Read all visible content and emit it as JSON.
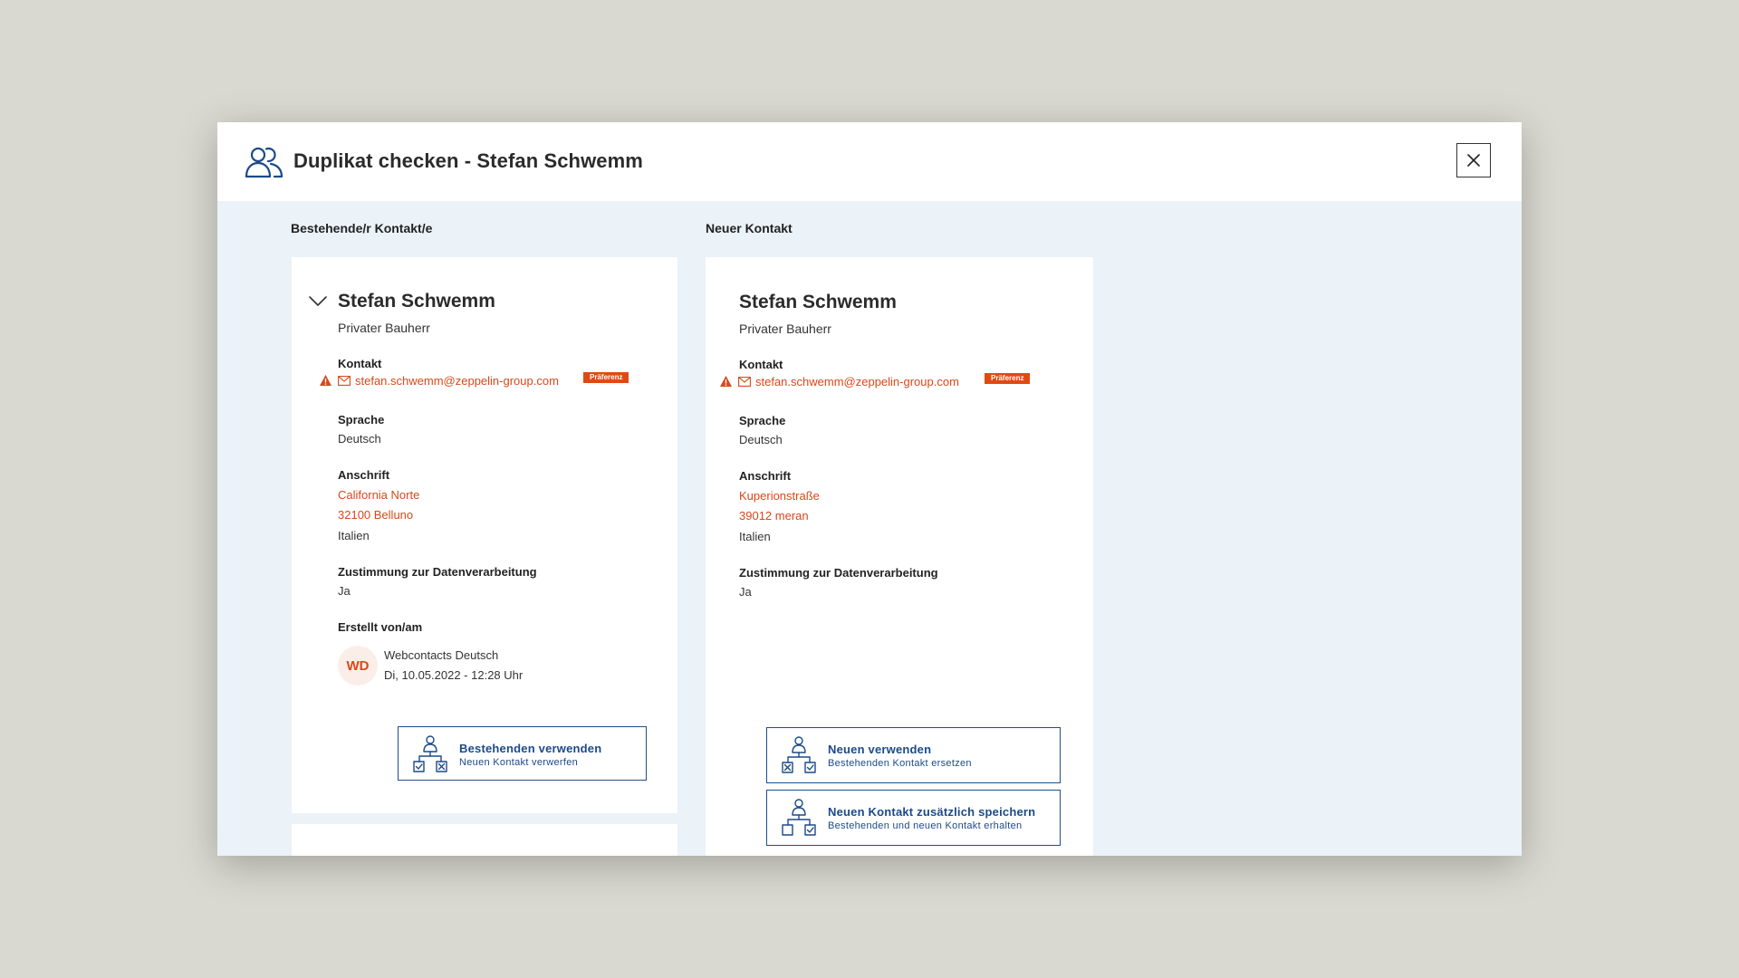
{
  "modal": {
    "title": "Duplikat checken - Stefan Schwemm"
  },
  "columns": {
    "existing_heading": "Bestehende/r Kontakt/e",
    "new_heading": "Neuer Kontakt"
  },
  "existing_contact": {
    "name": "Stefan Schwemm",
    "role": "Privater Bauherr",
    "contact_label": "Kontakt",
    "email": "stefan.schwemm@zeppelin-group.com",
    "preference_badge": "Präferenz",
    "language_label": "Sprache",
    "language": "Deutsch",
    "address_label": "Anschrift",
    "address_street": "California Norte",
    "address_city": "32100 Belluno",
    "address_country": "Italien",
    "consent_label": "Zustimmung zur Datenverarbeitung",
    "consent": "Ja",
    "created_label": "Erstellt von/am",
    "creator_initials": "WD",
    "creator_name": "Webcontacts Deutsch",
    "created_at": "Di, 10.05.2022 - 12:28 Uhr",
    "action": {
      "title": "Bestehenden verwenden",
      "subtitle": "Neuen Kontakt verwerfen"
    }
  },
  "new_contact": {
    "name": "Stefan Schwemm",
    "role": "Privater Bauherr",
    "contact_label": "Kontakt",
    "email": "stefan.schwemm@zeppelin-group.com",
    "preference_badge": "Präferenz",
    "language_label": "Sprache",
    "language": "Deutsch",
    "address_label": "Anschrift",
    "address_street": "Kuperionstraße",
    "address_city": "39012 meran",
    "address_country": "Italien",
    "consent_label": "Zustimmung zur Datenverarbeitung",
    "consent": "Ja",
    "action_use": {
      "title": "Neuen verwenden",
      "subtitle": "Bestehenden Kontakt ersetzen"
    },
    "action_save_additional": {
      "title": "Neuen Kontakt zusätzlich speichern",
      "subtitle": "Bestehenden und neuen Kontakt erhalten"
    }
  },
  "colors": {
    "accent_blue": "#1b4a8a",
    "accent_orange": "#e04a12",
    "panel_bg": "#ebf2f8"
  },
  "icons": {
    "header": "users-icon",
    "close": "close-icon",
    "collapse": "chevron-down-icon",
    "warning": "warning-icon",
    "mail": "mail-icon",
    "hierarchy": "hierarchy-icon"
  }
}
